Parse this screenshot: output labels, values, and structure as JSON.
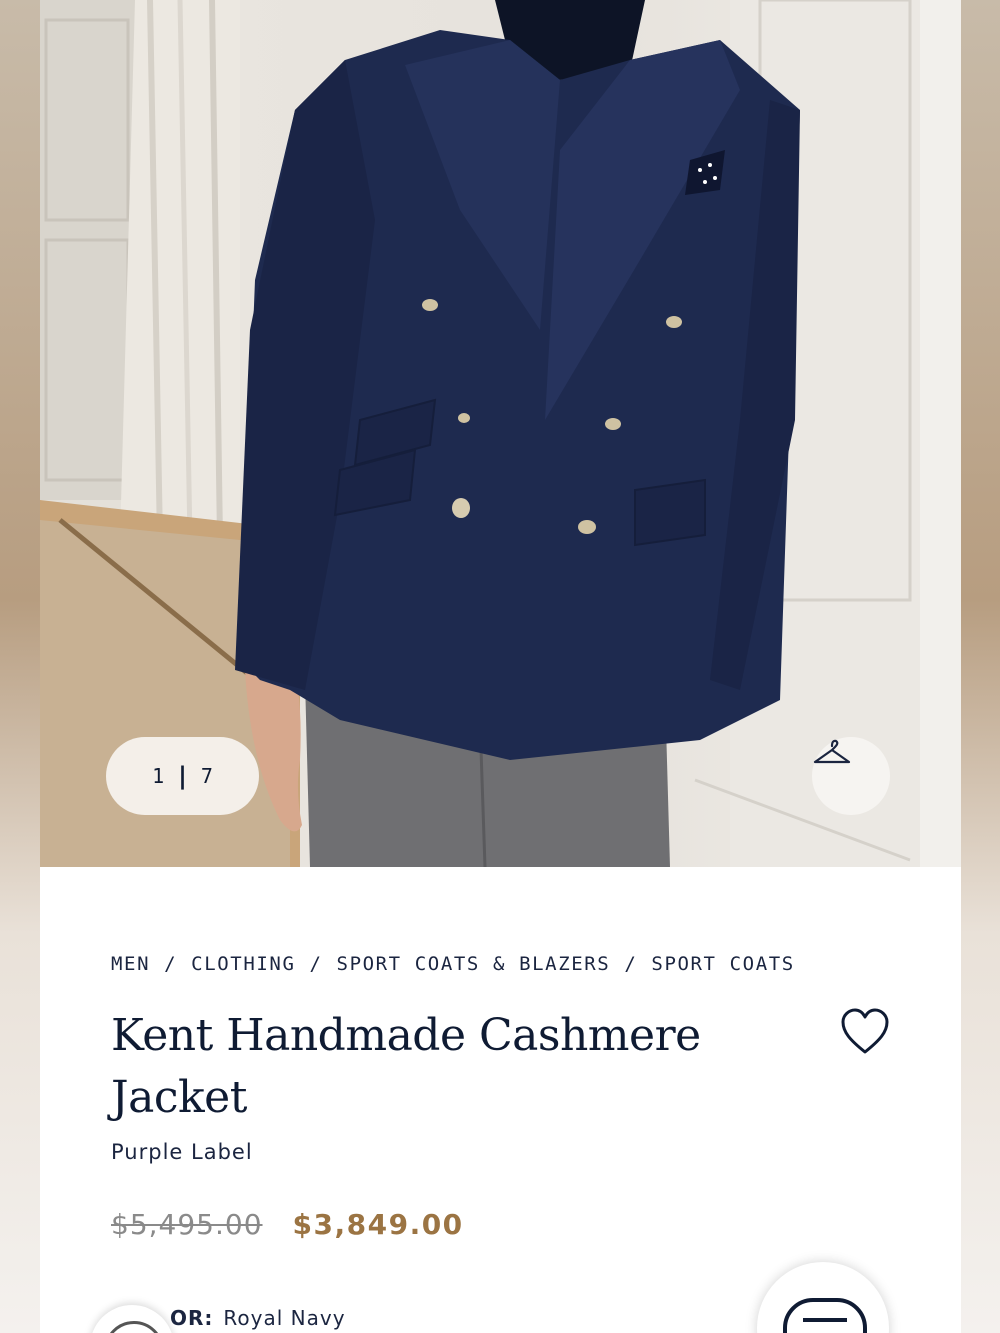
{
  "gallery": {
    "current": "1",
    "separator": "|",
    "total": "7",
    "hanger_icon": "hanger-icon"
  },
  "breadcrumb": {
    "items": [
      "MEN",
      "CLOTHING",
      "SPORT COATS & BLAZERS",
      "SPORT COATS"
    ],
    "separator": "/"
  },
  "product": {
    "title_line1": "Kent Handmade Cashmere",
    "title_line2": "Jacket",
    "brand": "Purple Label",
    "original_price": "$5,495.00",
    "sale_price": "$3,849.00",
    "color_label": "OR:",
    "color_value": "Royal Navy",
    "favorite_icon": "heart-icon"
  },
  "colors": {
    "text": "#0f1b33",
    "sale": "#9b7443",
    "strike": "#8a8a8a",
    "jacket": "#1e2a4f"
  },
  "chat": {
    "icon": "chat-icon"
  }
}
